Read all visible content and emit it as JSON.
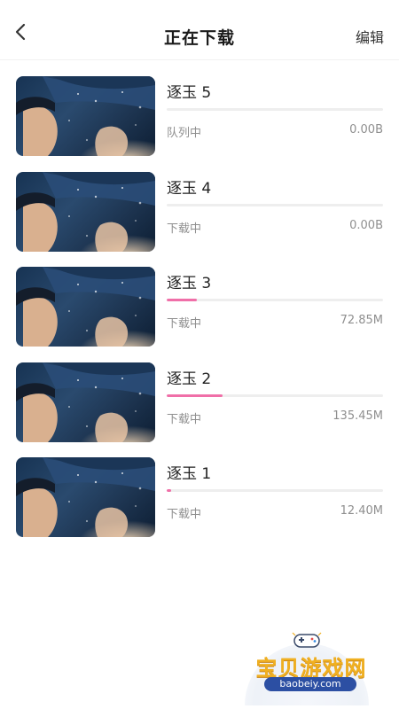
{
  "header": {
    "title": "正在下载",
    "edit_label": "编辑",
    "back_icon": "chevron-left-icon"
  },
  "accent_color": "#f06fa8",
  "downloads": [
    {
      "name": "逐玉 5",
      "status": "队列中",
      "size": "0.00B",
      "progress": 0
    },
    {
      "name": "逐玉 4",
      "status": "下载中",
      "size": "0.00B",
      "progress": 0
    },
    {
      "name": "逐玉 3",
      "status": "下载中",
      "size": "72.85M",
      "progress": 0.14
    },
    {
      "name": "逐玉 2",
      "status": "下载中",
      "size": "135.45M",
      "progress": 0.26
    },
    {
      "name": "逐玉 1",
      "status": "下载中",
      "size": "12.40M",
      "progress": 0.02
    }
  ],
  "watermark": {
    "text": "宝贝游戏网",
    "url": "baobeiy.com"
  }
}
